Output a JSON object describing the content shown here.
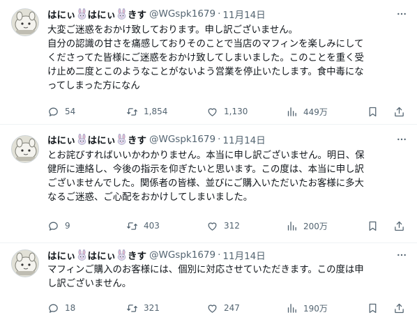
{
  "tweets": [
    {
      "display_name": [
        "はにぃ",
        "はにぃ",
        "きす"
      ],
      "handle": "@WGspk1679",
      "separator": "·",
      "date": "11月14日",
      "lines": [
        "大変ご迷惑をおかけ致しております。申し訳ございません。",
        "自分の認識の甘さを痛感しておりそのことで当店のマフィンを楽しみにして",
        "くださってた皆様にご迷惑をおかけ致してしまいました。このことを重く受",
        "け止め二度とこのようなことがないよう営業を停止いたします。食中毒にな",
        "ってしまった方になん"
      ],
      "replies": "54",
      "retweets": "1,854",
      "likes": "1,130",
      "views": "449万"
    },
    {
      "display_name": [
        "はにぃ",
        "はにぃ",
        "きす"
      ],
      "handle": "@WGspk1679",
      "separator": "·",
      "date": "11月14日",
      "lines": [
        "とお詫びすればいいかわかりません。本当に申し訳ございません。明日、保",
        "健所に連絡し、今後の指示を仰ぎたいと思います。この度は、本当に申し訳",
        "ございませんでした。関係者の皆様、並びにご購入いただいたお客様に多大",
        "なるご迷惑、ご心配をおかけしてしまいました。"
      ],
      "replies": "9",
      "retweets": "403",
      "likes": "312",
      "views": "200万"
    },
    {
      "display_name": [
        "はにぃ",
        "はにぃ",
        "きす"
      ],
      "handle": "@WGspk1679",
      "separator": "·",
      "date": "11月14日",
      "lines": [
        "マフィンご購入のお客様には、個別に対応させていただきます。この度は申",
        "し訳ございません。"
      ],
      "replies": "18",
      "retweets": "321",
      "likes": "247",
      "views": "190万"
    }
  ],
  "colors": {
    "text": "#0f1419",
    "secondary": "#536471",
    "divider": "#eff3f4"
  },
  "icons": {
    "reply": "speech-bubble-icon",
    "retweet": "retweet-arrows-icon",
    "like": "heart-icon",
    "views": "bar-chart-icon",
    "bookmark": "bookmark-icon",
    "share": "share-upload-icon",
    "more": "more-dots-icon",
    "name_emoji": "rabbit-face-icon"
  }
}
